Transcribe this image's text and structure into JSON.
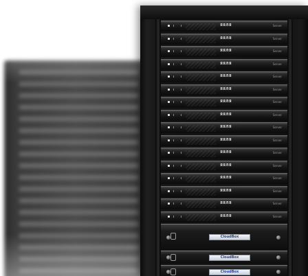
{
  "image": {
    "subject": "server rack",
    "server_units": {
      "count": 16,
      "brand_text": "ЯЯЛЯ",
      "model_text": "Server"
    },
    "storage_units": [
      {
        "plate_text": "CloudBox"
      },
      {
        "plate_text": "CloudBox"
      },
      {
        "plate_text": "CloudBox"
      }
    ],
    "colors": {
      "rack": "#121212",
      "background": "#ffffff",
      "accent_plate_text": "#1b3d8f"
    }
  }
}
